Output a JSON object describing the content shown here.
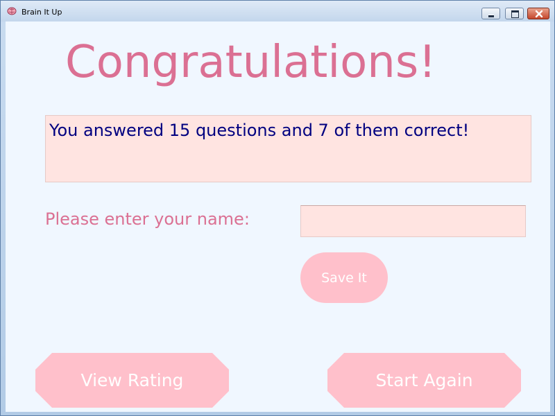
{
  "window": {
    "title": "Brain It Up",
    "icon": "brain-app-icon",
    "controls": [
      "minimize-icon",
      "maximize-icon",
      "close-icon"
    ]
  },
  "main": {
    "heading": "Congratulations!",
    "result_text": "You answered 15 questions and 7 of them correct!",
    "questions_answered": 15,
    "correct_answers": 7,
    "name_label": "Please enter your name:",
    "name_input_value": "",
    "save_button": "Save It"
  },
  "footer": {
    "view_rating_button": "View Rating",
    "start_again_button": "Start Again"
  },
  "colors": {
    "background": "#f0f7ff",
    "accent_text": "#db7093",
    "result_text": "#000080",
    "field_background": "#ffe4e1",
    "button_background": "#ffc0cb",
    "button_text": "#ffffff"
  }
}
